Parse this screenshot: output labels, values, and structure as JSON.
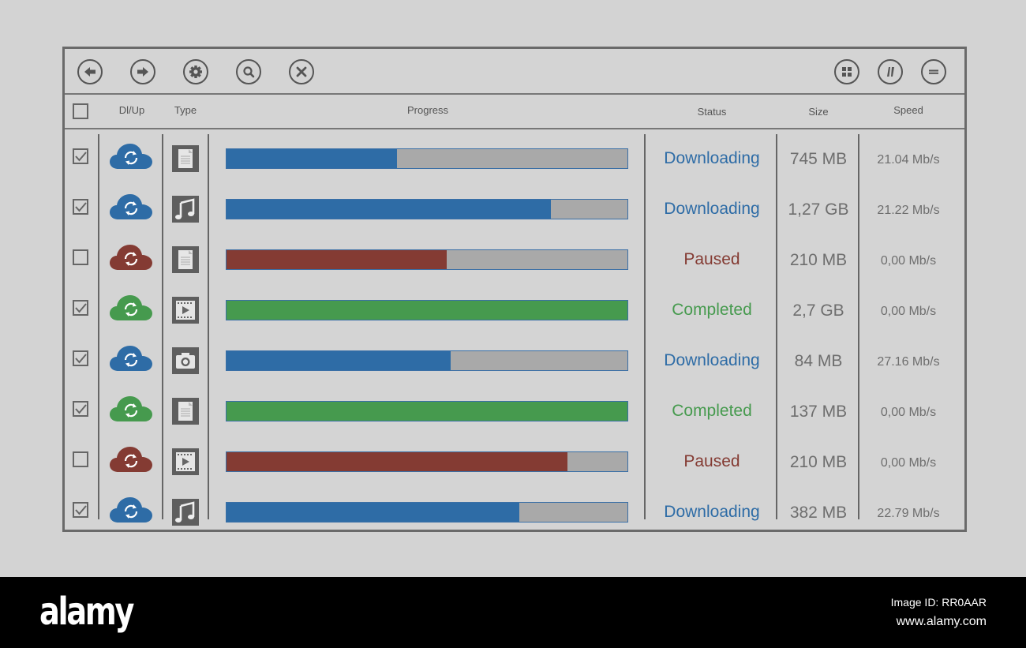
{
  "toolbar": {
    "left_buttons": [
      {
        "name": "back-button",
        "icon": "arrow-left-icon"
      },
      {
        "name": "forward-button",
        "icon": "arrow-right-icon"
      },
      {
        "name": "settings-button",
        "icon": "gear-icon"
      },
      {
        "name": "search-button",
        "icon": "search-icon"
      },
      {
        "name": "cancel-button",
        "icon": "close-icon"
      }
    ],
    "right_buttons": [
      {
        "name": "grid-view-button",
        "icon": "grid-icon"
      },
      {
        "name": "column-view-button",
        "icon": "columns-icon"
      },
      {
        "name": "list-view-button",
        "icon": "menu-icon"
      }
    ]
  },
  "header": {
    "select_all_checked": false,
    "columns": {
      "dlup": "Dl/Up",
      "type": "Type",
      "progress": "Progress",
      "status": "Status",
      "size": "Size",
      "speed": "Speed"
    }
  },
  "colors": {
    "downloading": "#2e6ca6",
    "paused": "#843b33",
    "completed": "#469a4e",
    "bar_track": "#a9a9a9"
  },
  "rows": [
    {
      "checked": true,
      "state": "downloading",
      "type": "document",
      "progress": 0.425,
      "status": "Downloading",
      "size": "745 MB",
      "speed": "21.04 Mb/s"
    },
    {
      "checked": true,
      "state": "downloading",
      "type": "music",
      "progress": 0.81,
      "status": "Downloading",
      "size": "1,27 GB",
      "speed": "21.22 Mb/s"
    },
    {
      "checked": false,
      "state": "paused",
      "type": "document",
      "progress": 0.55,
      "status": "Paused",
      "size": "210 MB",
      "speed": "0,00 Mb/s"
    },
    {
      "checked": true,
      "state": "completed",
      "type": "video",
      "progress": 1.0,
      "status": "Completed",
      "size": "2,7 GB",
      "speed": "0,00 Mb/s"
    },
    {
      "checked": true,
      "state": "downloading",
      "type": "photo",
      "progress": 0.56,
      "status": "Downloading",
      "size": "84 MB",
      "speed": "27.16 Mb/s"
    },
    {
      "checked": true,
      "state": "completed",
      "type": "document",
      "progress": 1.0,
      "status": "Completed",
      "size": "137 MB",
      "speed": "0,00 Mb/s"
    },
    {
      "checked": false,
      "state": "paused",
      "type": "video",
      "progress": 0.85,
      "status": "Paused",
      "size": "210 MB",
      "speed": "0,00 Mb/s"
    },
    {
      "checked": true,
      "state": "downloading",
      "type": "music",
      "progress": 0.73,
      "status": "Downloading",
      "size": "382 MB",
      "speed": "22.79 Mb/s"
    }
  ],
  "footer": {
    "logo": "alamy",
    "image_id": "Image ID: RR0AAR",
    "url": "www.alamy.com"
  }
}
